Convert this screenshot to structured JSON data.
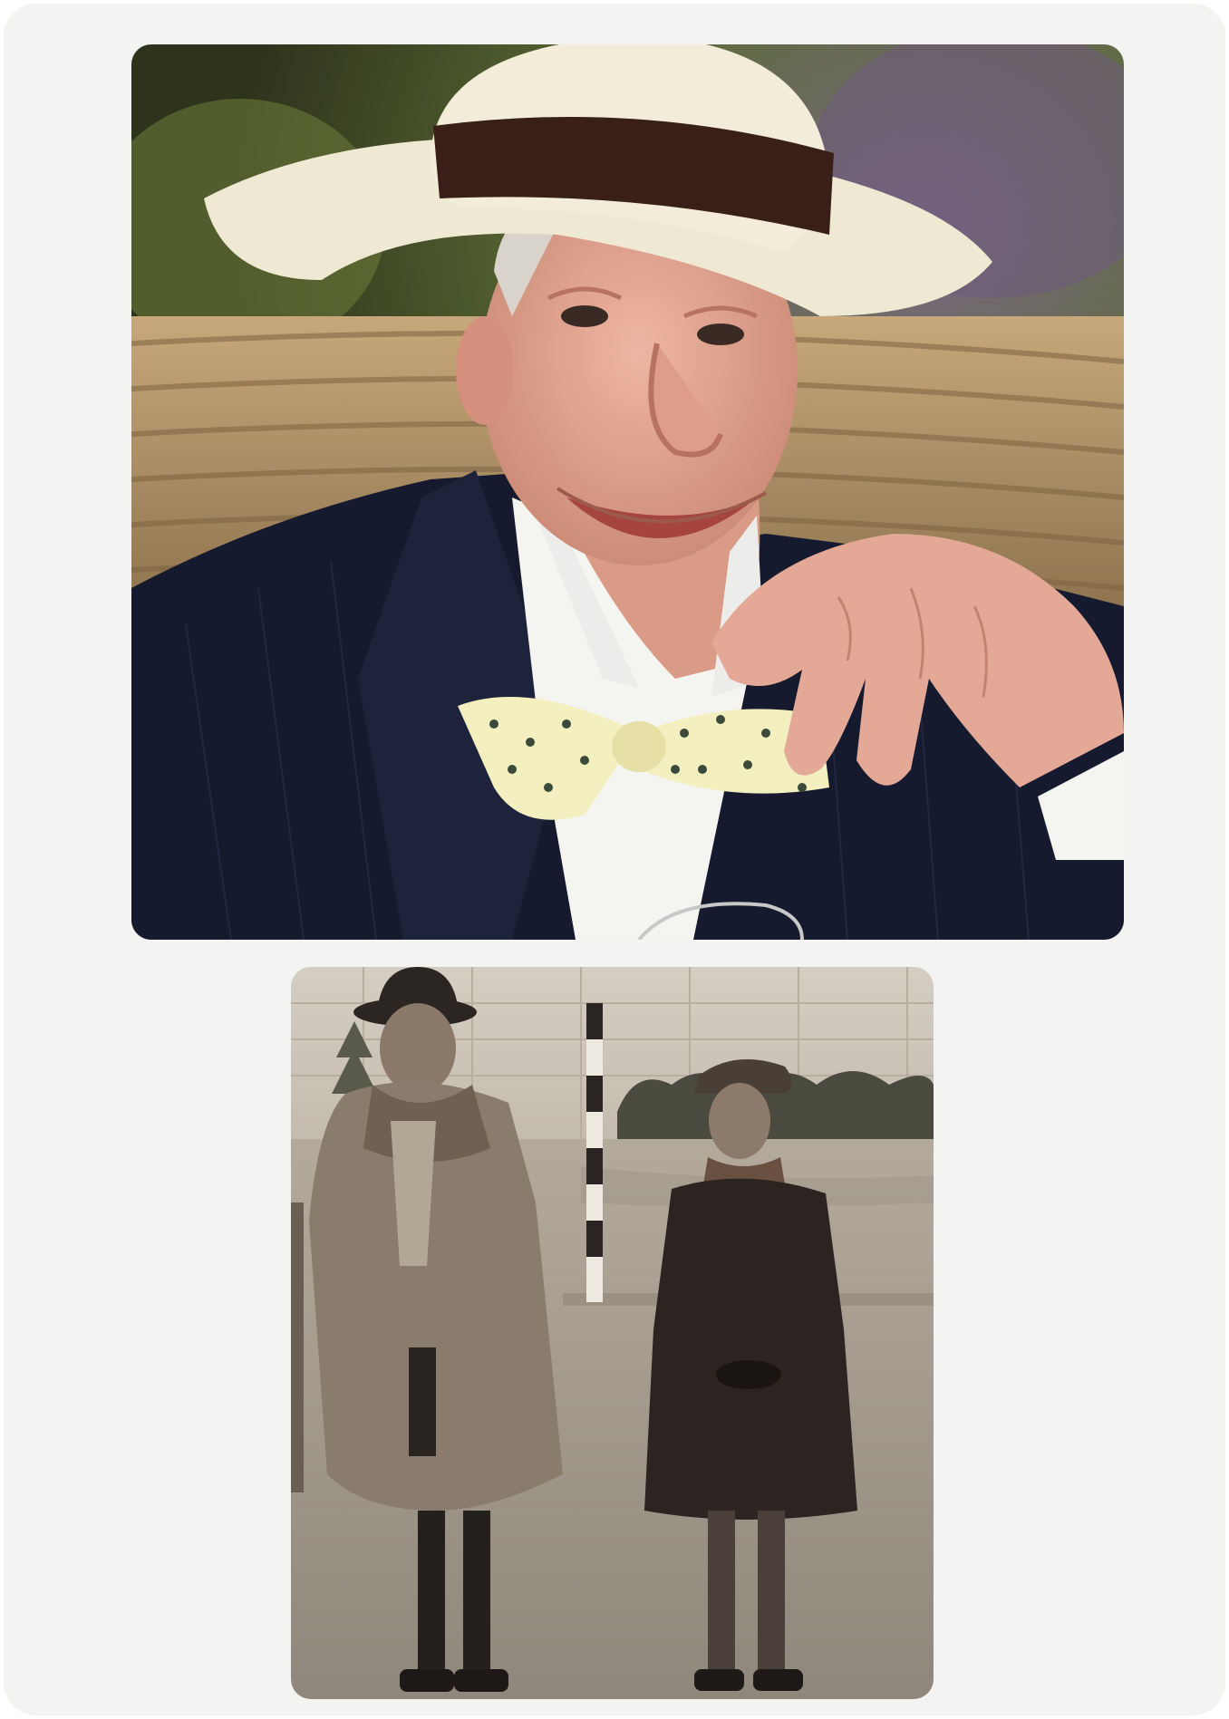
{
  "photos": [
    {
      "name": "color-portrait",
      "colors": {
        "background_green": "#5b6a34",
        "background_purple": "#5a3f66",
        "wicker": "#b39468",
        "hat": "#efe8d2",
        "hat_band": "#3a1f18",
        "skin": "#e2a48f",
        "suit": "#151a2e",
        "shirt": "#f4f4f0",
        "bow_tie": "#f3efbf"
      }
    },
    {
      "name": "sepia-street-photo",
      "colors": {
        "sky": "#d9d2c8",
        "building": "#cfc6b9",
        "ground": "#b7ada0",
        "coat": "#8a7c6c",
        "boy_coat": "#2b2420",
        "trees": "#4a4a3e"
      }
    }
  ]
}
